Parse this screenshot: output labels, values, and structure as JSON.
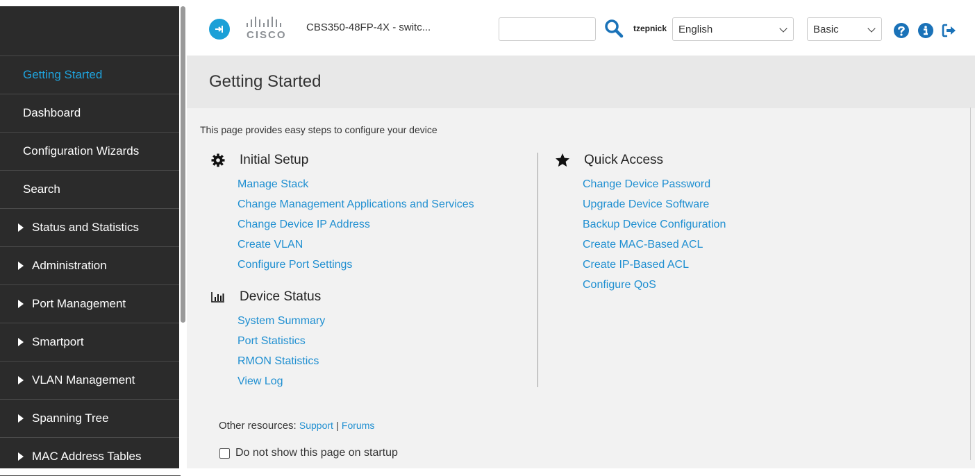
{
  "header": {
    "app_icon": "app-switch-icon",
    "logo_text": "CISCO",
    "device_name": "CBS350-48FP-4X - switc...",
    "search": {
      "value": "",
      "placeholder": ""
    },
    "username": "tzepnick",
    "language": "English",
    "mode": "Basic",
    "icons": [
      "search-icon",
      "help-icon",
      "info-icon",
      "logout-icon"
    ]
  },
  "sidebar": {
    "items": [
      {
        "label": "Getting Started",
        "active": true,
        "expandable": false
      },
      {
        "label": "Dashboard",
        "active": false,
        "expandable": false
      },
      {
        "label": "Configuration Wizards",
        "active": false,
        "expandable": false
      },
      {
        "label": "Search",
        "active": false,
        "expandable": false
      },
      {
        "label": "Status and Statistics",
        "active": false,
        "expandable": true
      },
      {
        "label": "Administration",
        "active": false,
        "expandable": true
      },
      {
        "label": "Port Management",
        "active": false,
        "expandable": true
      },
      {
        "label": "Smartport",
        "active": false,
        "expandable": true
      },
      {
        "label": "VLAN Management",
        "active": false,
        "expandable": true
      },
      {
        "label": "Spanning Tree",
        "active": false,
        "expandable": true
      },
      {
        "label": "MAC Address Tables",
        "active": false,
        "expandable": true
      }
    ]
  },
  "main": {
    "title": "Getting Started",
    "intro": "This page provides easy steps to configure your device",
    "initial_setup": {
      "heading": "Initial Setup",
      "icon": "gear-icon",
      "links": [
        "Manage Stack",
        "Change Management Applications and Services",
        "Change Device IP Address",
        "Create VLAN",
        "Configure Port Settings"
      ]
    },
    "device_status": {
      "heading": "Device Status",
      "icon": "bar-chart-icon",
      "links": [
        "System Summary",
        "Port Statistics",
        "RMON Statistics",
        "View Log"
      ]
    },
    "quick_access": {
      "heading": "Quick Access",
      "icon": "star-icon",
      "links": [
        "Change Device Password",
        "Upgrade Device Software",
        "Backup Device Configuration",
        "Create MAC-Based ACL",
        "Create IP-Based ACL",
        "Configure QoS"
      ]
    },
    "other_resources": {
      "label": "Other resources:",
      "support": "Support",
      "separator": "|",
      "forums": "Forums"
    },
    "startup_checkbox": {
      "label": "Do not show this page on startup",
      "checked": false
    }
  },
  "colors": {
    "accent": "#1ba0d7",
    "link": "#1f8fd1",
    "sidebar_bg": "#2b2b2b"
  }
}
